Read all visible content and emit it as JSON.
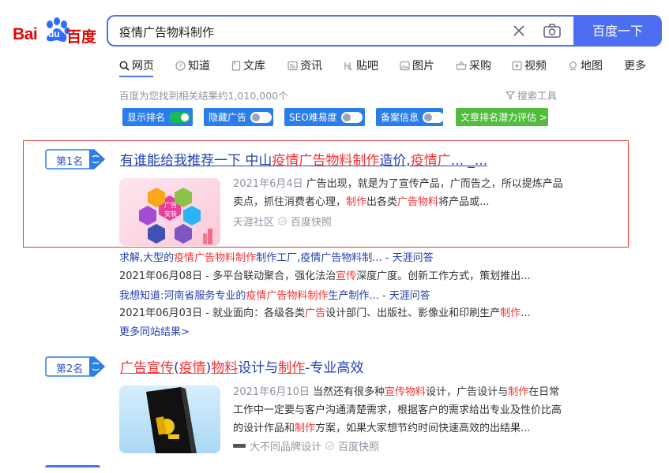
{
  "logo": {
    "bai": "Bai",
    "du": "du",
    "cn": "百度"
  },
  "search": {
    "query": "疫情广告物料制作",
    "button_label": "百度一下"
  },
  "tabs": [
    {
      "label": "网页",
      "icon": "search-icon",
      "active": true
    },
    {
      "label": "知道",
      "icon": "question-icon"
    },
    {
      "label": "文库",
      "icon": "document-icon"
    },
    {
      "label": "资讯",
      "icon": "news-icon"
    },
    {
      "label": "贴吧",
      "icon": "tieba-icon"
    },
    {
      "label": "图片",
      "icon": "image-icon"
    },
    {
      "label": "采购",
      "icon": "purchase-icon"
    },
    {
      "label": "视频",
      "icon": "video-icon"
    },
    {
      "label": "地图",
      "icon": "map-icon"
    },
    {
      "label": "更多",
      "icon": ""
    }
  ],
  "results_meta": {
    "count_text": "百度为您找到相关结果约1,010,000个",
    "search_tools": "搜索工具"
  },
  "plugins": [
    {
      "label": "显示排名",
      "state": "on"
    },
    {
      "label": "隐藏广告",
      "state": "off"
    },
    {
      "label": "SEO难易度",
      "state": "off"
    },
    {
      "label": "备案信息",
      "state": "off"
    },
    {
      "label": "文章排名潜力评估 >",
      "state": "none"
    }
  ],
  "colors": {
    "brand_blue": "#4e6ef2",
    "link_blue": "#2440b3",
    "highlight_red": "#f73131",
    "meta_gray": "#9195a3",
    "toggle_green": "#1cb95a",
    "chip_blue": "#2b7de9",
    "chip_green": "#52bd3d"
  },
  "result1": {
    "rank": "第1名",
    "title_pre": "有谁能给我推荐一下 中山",
    "title_hl": "疫情广告物料制作",
    "title_mid": "造价,",
    "title_hl2": "疫情广",
    "title_post": "... _...",
    "date": "2021年6月4日",
    "desc_1": " 广告出现，就是为了宣传产品，广而告之，所以提炼产品",
    "desc_2": "卖点，抓住消费者心理，",
    "desc_hl1": "制作",
    "desc_3": "出各类",
    "desc_hl2": "广告物料",
    "desc_4": "将产品或...",
    "source": "天涯社区",
    "snapshot": "百度快照",
    "thumb_labels": [
      "广告",
      "安装"
    ],
    "sub": [
      {
        "pre": "求解,大型的",
        "hl": "疫情广告物料制作",
        "post": "制作工厂,疫情广告物料制... - 天涯问答",
        "date": "2021年06月08日",
        "d_pre": " - 多平台联动聚合，强化法治",
        "d_hl": "宣传",
        "d_post": "深度广度。创新工作方式，策划推出..."
      },
      {
        "pre": "我想知道:河南省服务专业的",
        "hl": "疫情广告物料制作",
        "post": "生产制作... - 天涯问答",
        "date": "2021年06月03日",
        "d_pre": " - 就业面向：各级各类",
        "d_hl": "广告",
        "d_mid": "设计部门、出版社、影像业和印刷生产",
        "d_hl2": "制作",
        "d_post": "..."
      }
    ],
    "more_site": "更多同站结果>"
  },
  "result2": {
    "rank": "第2名",
    "t1": "广告宣传",
    "t2": "(",
    "t3": "疫情",
    "t4": ")",
    "t5": "物料",
    "t6": "设计与",
    "t7": "制作",
    "t8": "-专业高效",
    "date": "2021年6月10日",
    "d1": " 当然还有很多种",
    "d_hl1": "宣传物料",
    "d2": "设计，广告设计与",
    "d_hl2": "制作",
    "d3": "在日常",
    "d4": "工作中一定要与客户沟通清楚需求，根据客户的需求给出专业及性价比高",
    "d5": "的设计作品和",
    "d_hl3": "制作",
    "d6": "方案，如果大家想节约时间快速高效的出结果...",
    "source": "大不同品牌设计",
    "snapshot": "百度快照"
  }
}
